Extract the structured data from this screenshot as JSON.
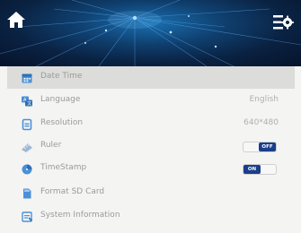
{
  "colors": {
    "accent": "#1a3e8a",
    "icon_blue": "#4a90d9",
    "label_gray": "#9a9a9a",
    "selected_row": "#dcdcda"
  },
  "header": {
    "home_icon": "home-icon",
    "settings_icon": "settings-gear-icon"
  },
  "menu": {
    "items": [
      {
        "label": "Date Time",
        "icon": "calendar-icon",
        "selected": true
      },
      {
        "label": "Language",
        "icon": "language-icon",
        "value": "English"
      },
      {
        "label": "Resolution",
        "icon": "resolution-icon",
        "value": "640*480"
      },
      {
        "label": "Ruler",
        "icon": "ruler-icon",
        "toggle": "OFF"
      },
      {
        "label": "TimeStamp",
        "icon": "timestamp-icon",
        "toggle": "ON"
      },
      {
        "label": "Format SD Card",
        "icon": "sd-card-icon"
      },
      {
        "label": "System Information",
        "icon": "system-info-icon"
      }
    ]
  }
}
